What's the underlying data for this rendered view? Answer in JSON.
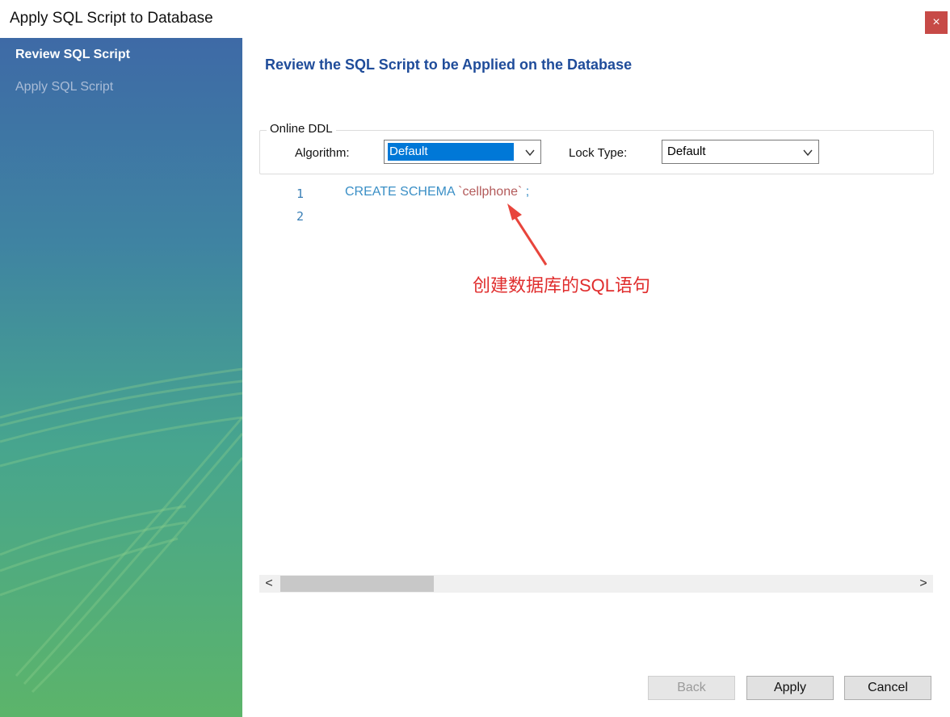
{
  "window": {
    "title": "Apply SQL Script to Database",
    "close_label": "×"
  },
  "sidebar": {
    "steps": [
      {
        "label": "Review SQL Script",
        "state": "active"
      },
      {
        "label": "Apply SQL Script",
        "state": "inactive"
      }
    ]
  },
  "main": {
    "heading": "Review the SQL Script to be Applied on the Database",
    "online_ddl": {
      "group_title": "Online DDL",
      "algorithm_label": "Algorithm:",
      "algorithm_value": "Default",
      "lock_type_label": "Lock Type:",
      "lock_type_value": "Default"
    },
    "editor": {
      "line_numbers": [
        "1",
        "2"
      ],
      "code_keyword": "CREATE SCHEMA ",
      "code_identifier": "`cellphone`",
      "code_tail": " ;"
    },
    "annotation": "创建数据库的SQL语句"
  },
  "scrollbar": {
    "left_arrow": "<",
    "right_arrow": ">"
  },
  "buttons": {
    "back": "Back",
    "apply": "Apply",
    "cancel": "Cancel"
  },
  "colors": {
    "heading": "#1f4c9a",
    "annotation": "#e02d2d",
    "selection": "#0078d7",
    "close": "#c74a47"
  }
}
